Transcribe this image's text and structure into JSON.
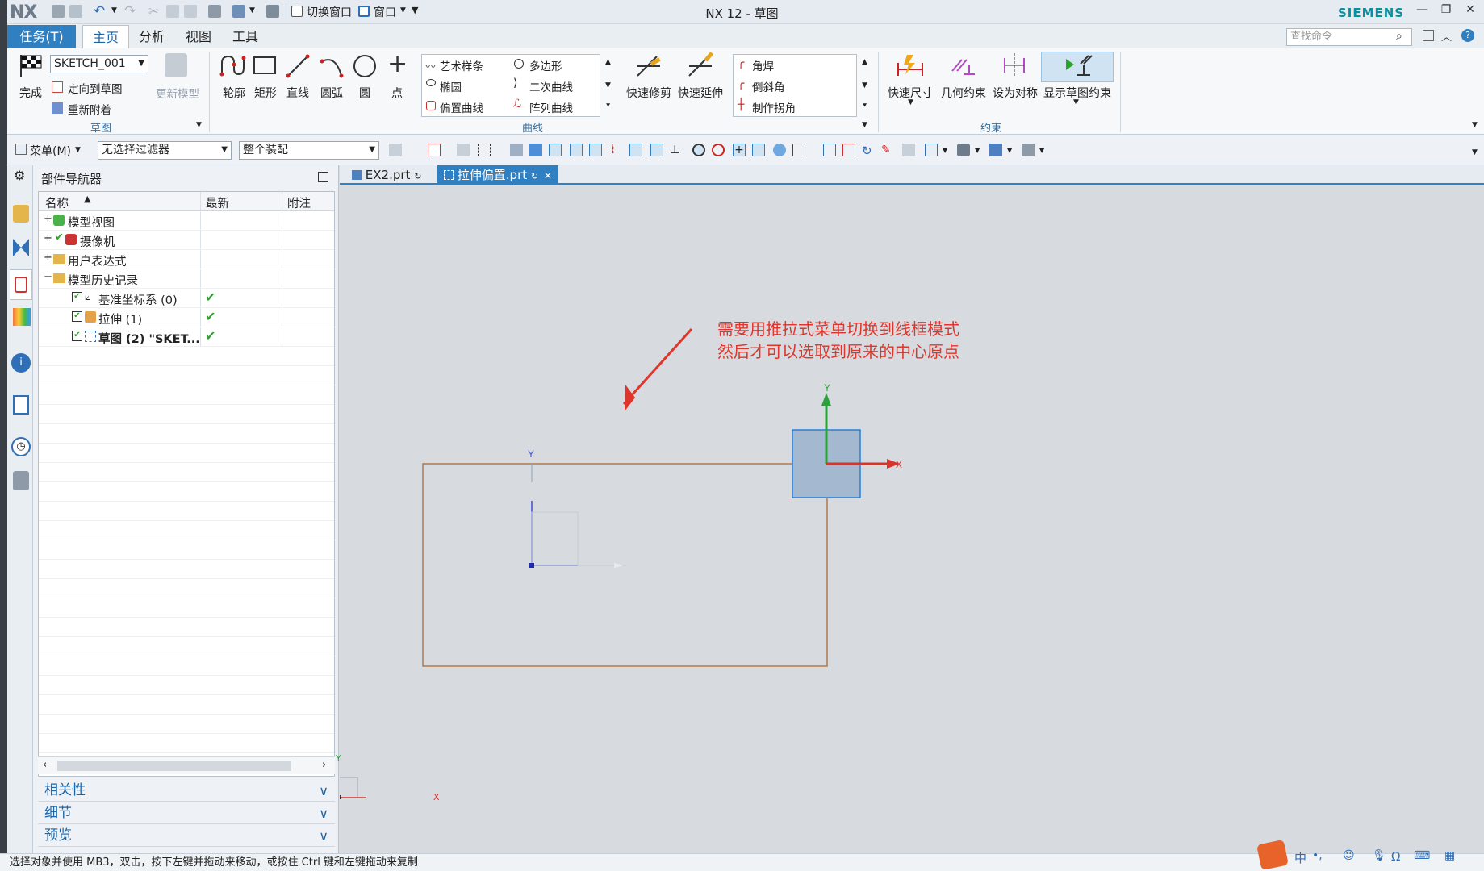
{
  "app": {
    "logo": "NX",
    "title": "NX 12 - 草图",
    "brand": "SIEMENS",
    "switch_window_label": "切换窗口",
    "window_label": "窗口"
  },
  "menu_tabs": {
    "task": "任务(T)",
    "home": "主页",
    "analysis": "分析",
    "view": "视图",
    "tools": "工具"
  },
  "search": {
    "placeholder": "查找命令"
  },
  "ribbon": {
    "sketch_group": {
      "finish": "完成",
      "sketch_name": "SKETCH_001",
      "orient_to_sketch": "定向到草图",
      "reattach": "重新附着",
      "update_model": "更新模型",
      "label": "草图"
    },
    "curve_group": {
      "profile": "轮廓",
      "rectangle": "矩形",
      "line": "直线",
      "arc": "圆弧",
      "circle": "圆",
      "point": "点",
      "studio_spline": "艺术样条",
      "ellipse": "椭圆",
      "offset_curve": "偏置曲线",
      "polygon": "多边形",
      "conic": "二次曲线",
      "pattern_curve": "阵列曲线",
      "quick_trim": "快速修剪",
      "quick_extend": "快速延伸",
      "fillet": "角焊",
      "chamfer": "倒斜角",
      "make_corner": "制作拐角",
      "label": "曲线"
    },
    "constraint_group": {
      "rapid_dimension": "快速尺寸",
      "geometric_constraints": "几何约束",
      "make_symmetric": "设为对称",
      "show_sketch_constraints": "显示草图约束",
      "label": "约束"
    }
  },
  "toolbar2": {
    "menu": "菜单(M)",
    "filter": "无选择过滤器",
    "assembly_scope": "整个装配"
  },
  "navigator": {
    "title": "部件导航器",
    "columns": [
      "名称",
      "最新",
      "附注"
    ],
    "rows": [
      {
        "label": "模型视图",
        "expander": "+",
        "check": "",
        "level": 0
      },
      {
        "label": "摄像机",
        "expander": "+",
        "check": "",
        "level": 0
      },
      {
        "label": "用户表达式",
        "expander": "+",
        "check": "",
        "level": 0
      },
      {
        "label": "模型历史记录",
        "expander": "−",
        "check": "",
        "level": 0
      },
      {
        "label": "基准坐标系 (0)",
        "expander": "",
        "check": "✔",
        "level": 1
      },
      {
        "label": "拉伸 (1)",
        "expander": "",
        "check": "✔",
        "level": 1
      },
      {
        "label": "草图 (2) \"SKET...",
        "expander": "",
        "check": "✔",
        "level": 1
      }
    ],
    "panels": [
      "相关性",
      "细节",
      "预览"
    ]
  },
  "doc_tabs": [
    "EX2.prt",
    "拉伸偏置.prt"
  ],
  "canvas": {
    "annotation_line1": "需要用推拉式菜单切换到线框模式",
    "annotation_line2": "然后才可以选取到原来的中心原点",
    "axis_x": "X",
    "axis_y": "Y"
  },
  "status": "选择对象并使用 MB3，双击，按下左键并拖动来移动，或按住 Ctrl 键和左键拖动来复制",
  "colors": {
    "accent": "#2f7fc1",
    "brand": "#0a8f9c",
    "annotation": "#e0352b",
    "check": "#2aa52a"
  }
}
